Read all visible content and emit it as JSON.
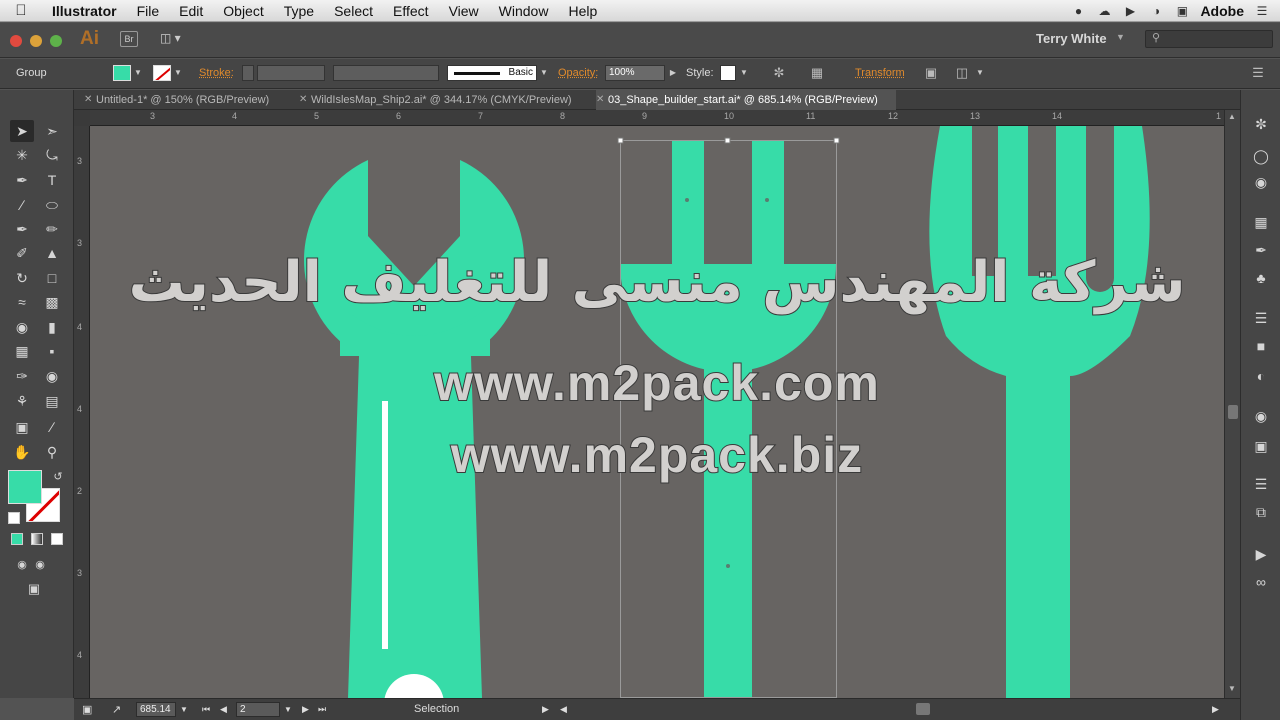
{
  "menubar": {
    "app_name": "Illustrator",
    "items": [
      "File",
      "Edit",
      "Object",
      "Type",
      "Select",
      "Effect",
      "View",
      "Window",
      "Help"
    ],
    "right_label": "Adobe"
  },
  "appbar": {
    "logo": "Ai",
    "bridge": "Br",
    "user": "Terry White"
  },
  "controlbar": {
    "selection_type": "Group",
    "stroke_label": "Stroke:",
    "brush_label": "Basic",
    "opacity_label": "Opacity:",
    "opacity_value": "100%",
    "style_label": "Style:",
    "transform_label": "Transform",
    "fill_color": "#37dca8"
  },
  "tabs": [
    {
      "label": "Untitled-1* @ 150% (RGB/Preview)",
      "active": false
    },
    {
      "label": "WildIslesMap_Ship2.ai* @ 344.17% (CMYK/Preview)",
      "active": false
    },
    {
      "label": "03_Shape_builder_start.ai* @ 685.14% (RGB/Preview)",
      "active": true
    }
  ],
  "rulers": {
    "horizontal": [
      "3",
      "4",
      "5",
      "6",
      "7",
      "8",
      "9",
      "10",
      "11",
      "12",
      "13",
      "14",
      "1"
    ],
    "vertical": [
      "3",
      "3",
      "4",
      "4",
      "2",
      "3",
      "4"
    ]
  },
  "watermark": {
    "arabic": "شركة المهندس منسى للتغليف الحديث",
    "url1": "www.m2pack.com",
    "url2": "www.m2pack.biz"
  },
  "statusbar": {
    "zoom": "685.14",
    "page": "2",
    "tool": "Selection"
  },
  "colors": {
    "artwork": "#37dca8",
    "canvas": "#676462",
    "accent_orange": "#e08a2c"
  },
  "icons": {
    "tools": [
      "selection-tool-icon",
      "direct-selection-tool-icon",
      "magic-wand-icon",
      "lasso-icon",
      "pen-icon",
      "type-icon",
      "line-icon",
      "ellipse-icon",
      "paintbrush-icon",
      "pencil-icon",
      "blob-brush-icon",
      "eraser-icon",
      "rotate-icon",
      "scale-icon",
      "warp-icon",
      "free-transform-icon",
      "shape-builder-icon",
      "perspective-icon",
      "mesh-icon",
      "gradient-icon",
      "eyedropper-icon",
      "blend-icon",
      "symbol-sprayer-icon",
      "graph-icon",
      "artboard-icon",
      "slice-icon",
      "hand-icon",
      "zoom-icon"
    ]
  }
}
